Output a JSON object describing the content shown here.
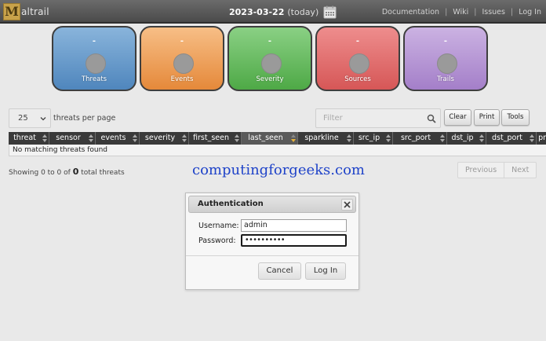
{
  "header": {
    "logo_mark": "M",
    "logo_text": "altrail",
    "date": "2023-03-22",
    "date_suffix": "(today)",
    "nav": [
      "Documentation",
      "Wiki",
      "Issues",
      "Log In"
    ]
  },
  "counters": [
    {
      "label": "Threats",
      "value": "-",
      "color": "#5b8fc4"
    },
    {
      "label": "Events",
      "value": "-",
      "color": "#ee9a4d"
    },
    {
      "label": "Severity",
      "value": "-",
      "color": "#5db856"
    },
    {
      "label": "Sources",
      "value": "-",
      "color": "#df6464"
    },
    {
      "label": "Trails",
      "value": "-",
      "color": "#b291d2"
    }
  ],
  "controls": {
    "per_page_value": "25",
    "per_page_label": "threats per page",
    "filter_placeholder": "Filter",
    "clear": "Clear",
    "print": "Print",
    "tools": "Tools"
  },
  "table": {
    "columns": [
      "threat",
      "sensor",
      "events",
      "severity",
      "first_seen",
      "last_seen",
      "sparkline",
      "src_ip",
      "src_port",
      "dst_ip",
      "dst_port",
      "pr"
    ],
    "sorted_column": "last_seen",
    "empty_message": "No matching threats found"
  },
  "info": {
    "prefix": "Showing 0 to 0 of",
    "total": "0",
    "suffix": "total threats"
  },
  "pager": {
    "previous": "Previous",
    "next": "Next"
  },
  "watermark": "computingforgeeks.com",
  "dialog": {
    "title": "Authentication",
    "username_label": "Username:",
    "username_value": "admin",
    "password_label": "Password:",
    "password_masked": "••••••••••",
    "cancel": "Cancel",
    "login": "Log In"
  }
}
